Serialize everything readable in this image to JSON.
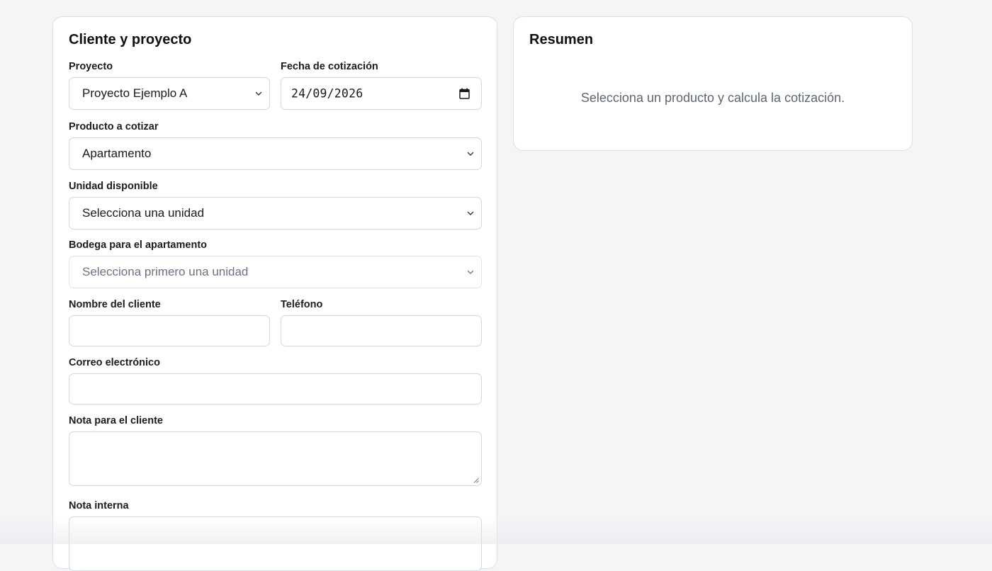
{
  "client_project": {
    "title": "Cliente y proyecto",
    "project": {
      "label": "Proyecto",
      "value": "Proyecto Ejemplo A"
    },
    "quote_date": {
      "label": "Fecha de cotización",
      "value": "24/09/2026"
    },
    "product": {
      "label": "Producto a cotizar",
      "value": "Apartamento"
    },
    "unit": {
      "label": "Unidad disponible",
      "value": "Selecciona una unidad"
    },
    "storage": {
      "label": "Bodega para el apartamento",
      "value": "Selecciona primero una unidad"
    },
    "client_name": {
      "label": "Nombre del cliente",
      "value": ""
    },
    "phone": {
      "label": "Teléfono",
      "value": ""
    },
    "email": {
      "label": "Correo electrónico",
      "value": ""
    },
    "client_note": {
      "label": "Nota para el cliente",
      "value": ""
    },
    "internal_note": {
      "label": "Nota interna",
      "value": ""
    }
  },
  "summary": {
    "title": "Resumen",
    "empty_message": "Selecciona un producto y calcula la cotización."
  },
  "icons": {
    "select": "chevron-down-icon",
    "date": "calendar-icon",
    "textarea": "resize-handle-icon"
  },
  "colors": {
    "page_background": "#f4f5f7",
    "card_background": "#ffffff",
    "border": "#d3d7dd",
    "muted_text": "#6b7280"
  }
}
